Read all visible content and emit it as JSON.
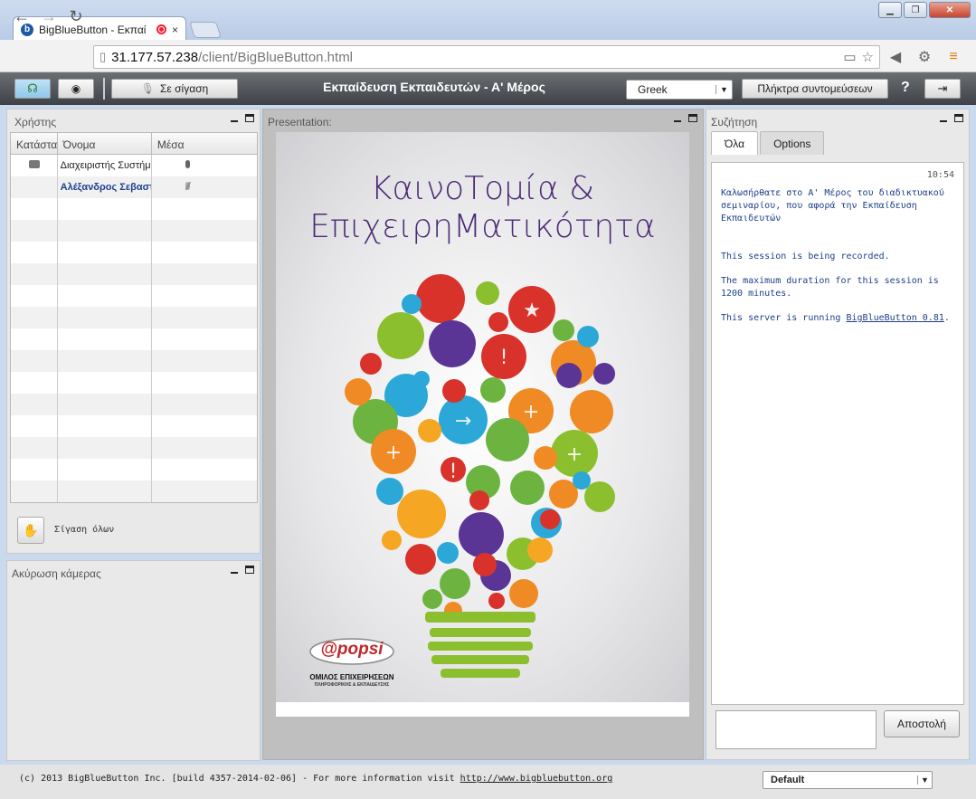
{
  "browser": {
    "tab_title": "BigBlueButton - Εκπαί",
    "tab_close": "×",
    "url_host": "31.177.57.238",
    "url_path": "/client/BigBlueButton.html"
  },
  "topbar": {
    "mute_label": "Σε σίγαση",
    "title": "Εκπαίδευση Εκπαιδευτών - Α' Μέρος",
    "language": "Greek",
    "shortcuts_label": "Πλήκτρα συντομεύσεων",
    "help_label": "?"
  },
  "users": {
    "title": "Χρήστης",
    "columns": [
      "Κατάστασ",
      "Όνομα",
      "Μέσα"
    ],
    "rows": [
      {
        "name": "Διαχειριστής Συστήματος"
      },
      {
        "name": "Αλέξανδρος Σεβαστός"
      }
    ],
    "mute_all_label": "Σίγαση όλων"
  },
  "webcam": {
    "title": "Ακύρωση κάμερας"
  },
  "presentation": {
    "title": "Presentation:",
    "slide_title_line1": "ΚαινοΤομία &",
    "slide_title_line2": "ΕπιχειρηΜατικότητα",
    "logo_text": "@popsi",
    "logo_sub1": "ΟΜΙΛΟΣ ΕΠΙΧΕΙΡΗΣΕΩΝ",
    "logo_sub2": "ΠΛΗΡΟΦΟΡΙΚΗΣ & ΕΚΠΑΙΔΕΥΣΗΣ"
  },
  "chat": {
    "title": "Συζήτηση",
    "tab_all": "Όλα",
    "tab_options": "Options",
    "time": "10:54",
    "welcome": "Καλωσήρθατε στο Α' Μέρος του διαδικτυακού σεμιναρίου, που αφορά την Εκπαίδευση Εκπαιδευτών",
    "recorded": "This session is being recorded.",
    "duration": "The maximum duration for this session is 1200 minutes.",
    "server_prefix": "This server is running ",
    "server_link": "BigBlueButton 0.81",
    "server_suffix": ".",
    "send_label": "Αποστολή"
  },
  "footer": {
    "copyright": "(c) 2013 BigBlueButton Inc. [build 4357-2014-02-06] - For more information visit ",
    "link": "http://www.bigbluebutton.org",
    "layout": "Default"
  },
  "colors": {
    "accent": "#4b2a74",
    "chat_text": "#1f3f8a"
  }
}
